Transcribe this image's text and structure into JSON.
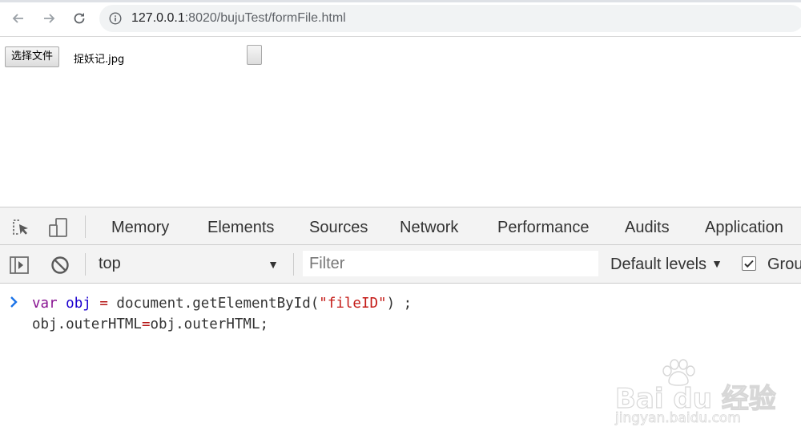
{
  "browser": {
    "url_host": "127.0.0.1",
    "url_rest": ":8020/bujuTest/formFile.html"
  },
  "page": {
    "file_button_label": "选择文件",
    "file_name": "捉妖记.jpg"
  },
  "devtools": {
    "tabs": [
      {
        "label": "Memory"
      },
      {
        "label": "Elements"
      },
      {
        "label": "Sources"
      },
      {
        "label": "Network"
      },
      {
        "label": "Performance"
      },
      {
        "label": "Audits"
      },
      {
        "label": "Application"
      }
    ],
    "console": {
      "context": "top",
      "filter_placeholder": "Filter",
      "levels": "Default levels",
      "group_label": "Grou",
      "group_checked": true
    },
    "code": {
      "line1_kw": "var",
      "line1_var": "obj",
      "line1_op": "=",
      "line1_call": "document.getElementById(",
      "line1_str": "\"fileID\"",
      "line1_end": ") ;",
      "line2_left": "obj.outerHTML",
      "line2_op": "=",
      "line2_right": "obj.outerHTML;"
    }
  },
  "watermark": {
    "logo": "Bai du 经验",
    "sub": "jingyan.baidu.com"
  }
}
